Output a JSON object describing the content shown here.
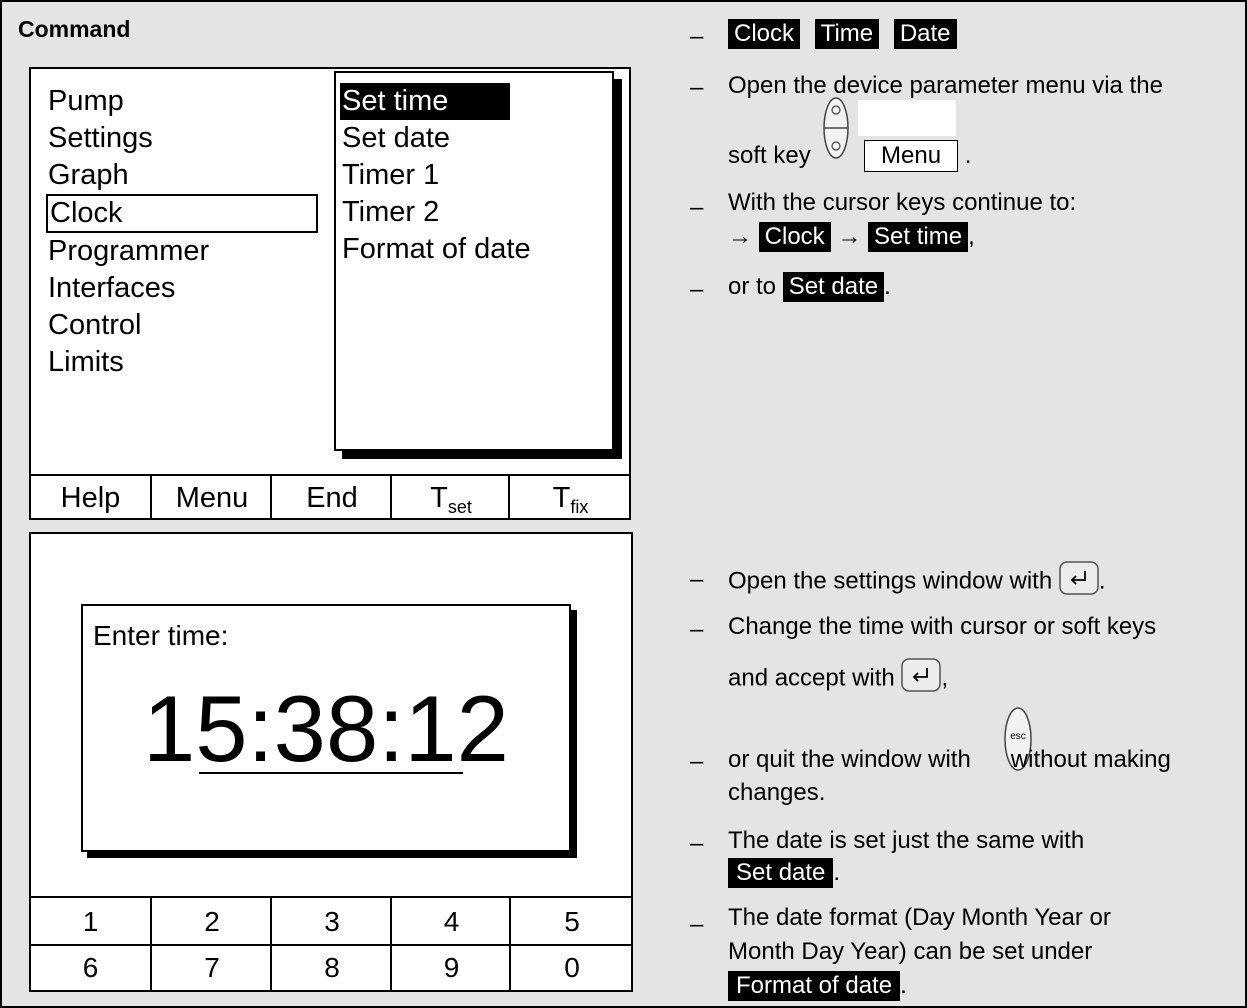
{
  "header": {
    "command_label": "Command",
    "keys": [
      "Clock",
      "Time",
      "Date"
    ]
  },
  "screen1": {
    "main_menu": [
      "Pump",
      "Settings",
      "Graph",
      "Clock",
      "Programmer",
      "Interfaces",
      "Control",
      "Limits"
    ],
    "selected_main": "Clock",
    "submenu": [
      "Set time",
      "Set date",
      "Timer 1",
      "Timer 2",
      "Format of date"
    ],
    "selected_sub": "Set time",
    "softkeys": {
      "help": "Help",
      "menu": "Menu",
      "end": "End",
      "tset_main": "T",
      "tset_sub": "set",
      "tfix_main": "T",
      "tfix_sub": "fix"
    }
  },
  "screen2": {
    "dialog_label": "Enter time:",
    "time_value": "15:38:12",
    "keypad_row1": [
      "1",
      "2",
      "3",
      "4",
      "5"
    ],
    "keypad_row2": [
      "6",
      "7",
      "8",
      "9",
      "0"
    ]
  },
  "instructions": {
    "dash": "–",
    "s1_line1": "Open the device parameter menu via the",
    "s1_line2": "soft key",
    "s1_menu_key": "Menu",
    "s1_period": ".",
    "s2_line1": "With the cursor keys continue to:",
    "s2_arrow": "→",
    "s2_clock": "Clock",
    "s2_settime": "Set time",
    "s2_comma": ",",
    "s3_or_to": "or to",
    "s3_setdate": "Set date",
    "s3_period": ".",
    "s4_text": "Open the settings window with",
    "s4_period": ".",
    "s5_line1": "Change the time with cursor or soft keys",
    "s5_line2": "and accept with",
    "s5_comma": ",",
    "s6_line1a": "or quit the window with",
    "s6_line1b": "without making",
    "s6_line2": "changes.",
    "s7_line1": "The date is set just the same with",
    "s7_setdate": "Set date",
    "s7_period": ".",
    "s8_line1": "The date format (Day Month Year or",
    "s8_line2": "Month Day Year) can be set under",
    "s8_format": "Format of date",
    "s8_period": ".",
    "esc_label": "esc"
  }
}
